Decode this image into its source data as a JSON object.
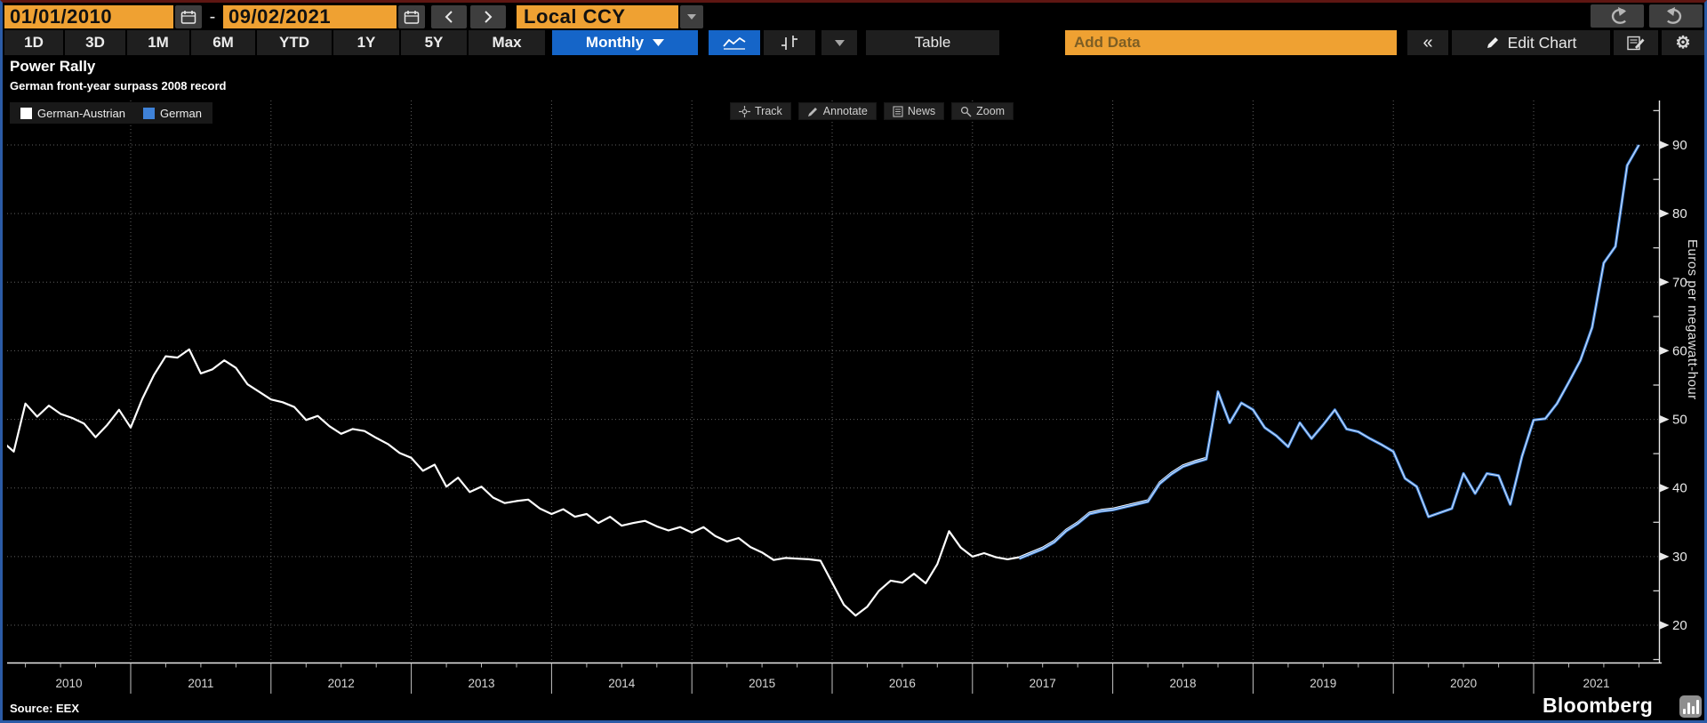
{
  "toolbar_top": {
    "date_start": "01/01/2010",
    "date_separator": "-",
    "date_end": "09/02/2021",
    "currency": "Local CCY"
  },
  "toolbar_main": {
    "ranges": [
      "1D",
      "3D",
      "1M",
      "6M",
      "YTD",
      "1Y",
      "5Y",
      "Max"
    ],
    "frequency": "Monthly",
    "table_label": "Table",
    "add_data_placeholder": "Add Data",
    "collapse_label": "«",
    "edit_chart_label": "Edit Chart"
  },
  "icons": {
    "calendar": "calendar-icon",
    "prev": "chevron-left-icon",
    "next": "chevron-right-icon",
    "undo": "undo-icon",
    "redo": "redo-icon",
    "line_chart": "line-chart-icon",
    "ohlc": "ohlc-bars-icon",
    "caret": "chevron-down-icon",
    "pencil": "pencil-icon",
    "annotate_doc": "annotate-document-icon",
    "gear": "gear-icon"
  },
  "chart_header": {
    "title": "Power Rally",
    "subtitle": "German front-year surpass 2008 record"
  },
  "chart_tools": [
    {
      "label": "Track",
      "icon": "crosshair-icon"
    },
    {
      "label": "Annotate",
      "icon": "pencil-icon"
    },
    {
      "label": "News",
      "icon": "news-icon"
    },
    {
      "label": "Zoom",
      "icon": "magnifier-icon"
    }
  ],
  "legend": [
    {
      "label": "German-Austrian",
      "color": "#FFFFFF"
    },
    {
      "label": "German",
      "color": "#3F82D8"
    }
  ],
  "source": "Source: EEX",
  "brand": "Bloomberg",
  "colors": {
    "accent_orange": "#EFA132",
    "accent_blue": "#1565C8",
    "line_white": "#FFFFFF",
    "line_blue": "#3F82D8",
    "grid": "#616161"
  },
  "chart_data": {
    "type": "line",
    "title": "Power Rally",
    "subtitle": "German front-year surpass 2008 record",
    "xlabel": "",
    "ylabel": "Euros per megawatt-hour",
    "ylim": [
      15,
      96
    ],
    "yticks": [
      20,
      30,
      40,
      50,
      60,
      70,
      80,
      90
    ],
    "x_years": [
      2010,
      2011,
      2012,
      2013,
      2014,
      2015,
      2016,
      2017,
      2018,
      2019,
      2020,
      2021
    ],
    "grid": "dotted",
    "legend_position": "top-left",
    "series": [
      {
        "name": "German-Austrian",
        "color": "#FFFFFF",
        "start_year": 2010,
        "start_month": 1,
        "monthly_values": [
          49.0,
          46.8,
          45.3,
          52.3,
          50.4,
          52.0,
          50.8,
          50.2,
          49.4,
          47.4,
          49.2,
          51.4,
          48.8,
          53.0,
          56.5,
          59.2,
          59.0,
          60.2,
          56.7,
          57.3,
          58.6,
          57.5,
          55.1,
          54.0,
          52.9,
          52.5,
          51.8,
          49.9,
          50.5,
          49.0,
          47.9,
          48.6,
          48.3,
          47.3,
          46.4,
          45.1,
          44.4,
          42.5,
          43.4,
          40.2,
          41.5,
          39.4,
          40.2,
          38.6,
          37.8,
          38.1,
          38.3,
          37.0,
          36.2,
          36.9,
          35.8,
          36.2,
          34.9,
          35.8,
          34.5,
          34.9,
          35.2,
          34.4,
          33.8,
          34.3,
          33.5,
          34.3,
          33.0,
          32.2,
          32.7,
          31.4,
          30.6,
          29.5,
          29.8,
          29.7,
          29.6,
          29.4,
          26.2,
          23.0,
          21.4,
          22.7,
          25.0,
          26.5,
          26.2,
          27.5,
          26.1,
          28.9,
          33.7,
          31.3,
          30.0,
          30.5,
          29.9,
          29.6,
          29.9,
          30.6,
          31.3,
          32.3,
          33.9,
          35.0,
          36.4,
          36.8,
          37.0,
          37.4,
          37.8,
          38.2,
          40.8,
          42.2,
          43.3,
          43.9,
          44.4,
          54.2
        ]
      },
      {
        "name": "German",
        "color": "#3F82D8",
        "start_year": 2017,
        "start_month": 5,
        "monthly_values": [
          29.7,
          30.4,
          31.1,
          32.1,
          33.7,
          34.8,
          36.2,
          36.6,
          36.8,
          37.2,
          37.6,
          38.0,
          40.6,
          42.0,
          43.1,
          43.7,
          44.2,
          54.0,
          49.5,
          52.4,
          51.4,
          48.8,
          47.6,
          46.0,
          49.5,
          47.2,
          49.2,
          51.4,
          48.6,
          48.2,
          47.2,
          46.3,
          45.3,
          41.4,
          40.2,
          35.8,
          36.4,
          37.0,
          42.1,
          39.2,
          42.1,
          41.8,
          37.6,
          44.6,
          49.9,
          50.1,
          52.3,
          55.4,
          58.6,
          63.4,
          72.8,
          75.2,
          87.0
        ],
        "extra_points": [
          [
            2021.75,
            90.0
          ]
        ]
      }
    ]
  }
}
